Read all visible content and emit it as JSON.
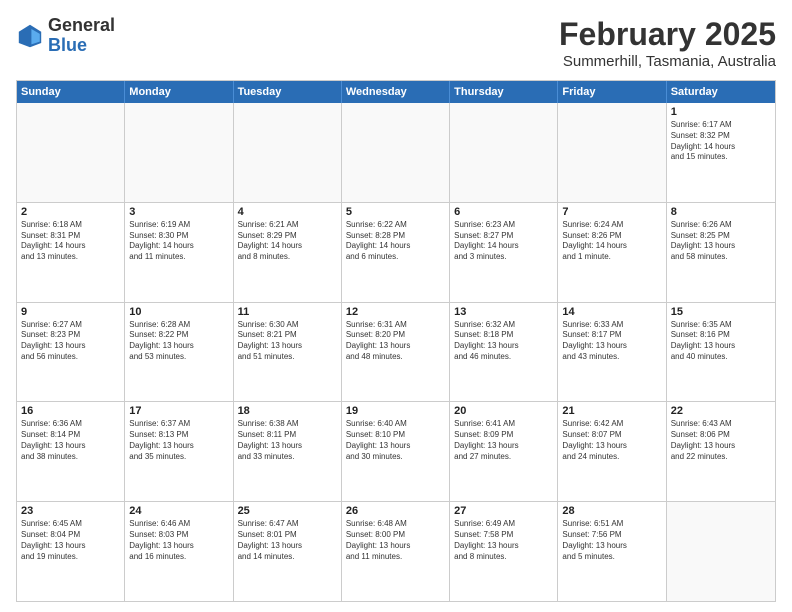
{
  "logo": {
    "general": "General",
    "blue": "Blue"
  },
  "title": "February 2025",
  "subtitle": "Summerhill, Tasmania, Australia",
  "days": [
    "Sunday",
    "Monday",
    "Tuesday",
    "Wednesday",
    "Thursday",
    "Friday",
    "Saturday"
  ],
  "weeks": [
    [
      {
        "day": "",
        "info": ""
      },
      {
        "day": "",
        "info": ""
      },
      {
        "day": "",
        "info": ""
      },
      {
        "day": "",
        "info": ""
      },
      {
        "day": "",
        "info": ""
      },
      {
        "day": "",
        "info": ""
      },
      {
        "day": "1",
        "info": "Sunrise: 6:17 AM\nSunset: 8:32 PM\nDaylight: 14 hours\nand 15 minutes."
      }
    ],
    [
      {
        "day": "2",
        "info": "Sunrise: 6:18 AM\nSunset: 8:31 PM\nDaylight: 14 hours\nand 13 minutes."
      },
      {
        "day": "3",
        "info": "Sunrise: 6:19 AM\nSunset: 8:30 PM\nDaylight: 14 hours\nand 11 minutes."
      },
      {
        "day": "4",
        "info": "Sunrise: 6:21 AM\nSunset: 8:29 PM\nDaylight: 14 hours\nand 8 minutes."
      },
      {
        "day": "5",
        "info": "Sunrise: 6:22 AM\nSunset: 8:28 PM\nDaylight: 14 hours\nand 6 minutes."
      },
      {
        "day": "6",
        "info": "Sunrise: 6:23 AM\nSunset: 8:27 PM\nDaylight: 14 hours\nand 3 minutes."
      },
      {
        "day": "7",
        "info": "Sunrise: 6:24 AM\nSunset: 8:26 PM\nDaylight: 14 hours\nand 1 minute."
      },
      {
        "day": "8",
        "info": "Sunrise: 6:26 AM\nSunset: 8:25 PM\nDaylight: 13 hours\nand 58 minutes."
      }
    ],
    [
      {
        "day": "9",
        "info": "Sunrise: 6:27 AM\nSunset: 8:23 PM\nDaylight: 13 hours\nand 56 minutes."
      },
      {
        "day": "10",
        "info": "Sunrise: 6:28 AM\nSunset: 8:22 PM\nDaylight: 13 hours\nand 53 minutes."
      },
      {
        "day": "11",
        "info": "Sunrise: 6:30 AM\nSunset: 8:21 PM\nDaylight: 13 hours\nand 51 minutes."
      },
      {
        "day": "12",
        "info": "Sunrise: 6:31 AM\nSunset: 8:20 PM\nDaylight: 13 hours\nand 48 minutes."
      },
      {
        "day": "13",
        "info": "Sunrise: 6:32 AM\nSunset: 8:18 PM\nDaylight: 13 hours\nand 46 minutes."
      },
      {
        "day": "14",
        "info": "Sunrise: 6:33 AM\nSunset: 8:17 PM\nDaylight: 13 hours\nand 43 minutes."
      },
      {
        "day": "15",
        "info": "Sunrise: 6:35 AM\nSunset: 8:16 PM\nDaylight: 13 hours\nand 40 minutes."
      }
    ],
    [
      {
        "day": "16",
        "info": "Sunrise: 6:36 AM\nSunset: 8:14 PM\nDaylight: 13 hours\nand 38 minutes."
      },
      {
        "day": "17",
        "info": "Sunrise: 6:37 AM\nSunset: 8:13 PM\nDaylight: 13 hours\nand 35 minutes."
      },
      {
        "day": "18",
        "info": "Sunrise: 6:38 AM\nSunset: 8:11 PM\nDaylight: 13 hours\nand 33 minutes."
      },
      {
        "day": "19",
        "info": "Sunrise: 6:40 AM\nSunset: 8:10 PM\nDaylight: 13 hours\nand 30 minutes."
      },
      {
        "day": "20",
        "info": "Sunrise: 6:41 AM\nSunset: 8:09 PM\nDaylight: 13 hours\nand 27 minutes."
      },
      {
        "day": "21",
        "info": "Sunrise: 6:42 AM\nSunset: 8:07 PM\nDaylight: 13 hours\nand 24 minutes."
      },
      {
        "day": "22",
        "info": "Sunrise: 6:43 AM\nSunset: 8:06 PM\nDaylight: 13 hours\nand 22 minutes."
      }
    ],
    [
      {
        "day": "23",
        "info": "Sunrise: 6:45 AM\nSunset: 8:04 PM\nDaylight: 13 hours\nand 19 minutes."
      },
      {
        "day": "24",
        "info": "Sunrise: 6:46 AM\nSunset: 8:03 PM\nDaylight: 13 hours\nand 16 minutes."
      },
      {
        "day": "25",
        "info": "Sunrise: 6:47 AM\nSunset: 8:01 PM\nDaylight: 13 hours\nand 14 minutes."
      },
      {
        "day": "26",
        "info": "Sunrise: 6:48 AM\nSunset: 8:00 PM\nDaylight: 13 hours\nand 11 minutes."
      },
      {
        "day": "27",
        "info": "Sunrise: 6:49 AM\nSunset: 7:58 PM\nDaylight: 13 hours\nand 8 minutes."
      },
      {
        "day": "28",
        "info": "Sunrise: 6:51 AM\nSunset: 7:56 PM\nDaylight: 13 hours\nand 5 minutes."
      },
      {
        "day": "",
        "info": ""
      }
    ]
  ]
}
